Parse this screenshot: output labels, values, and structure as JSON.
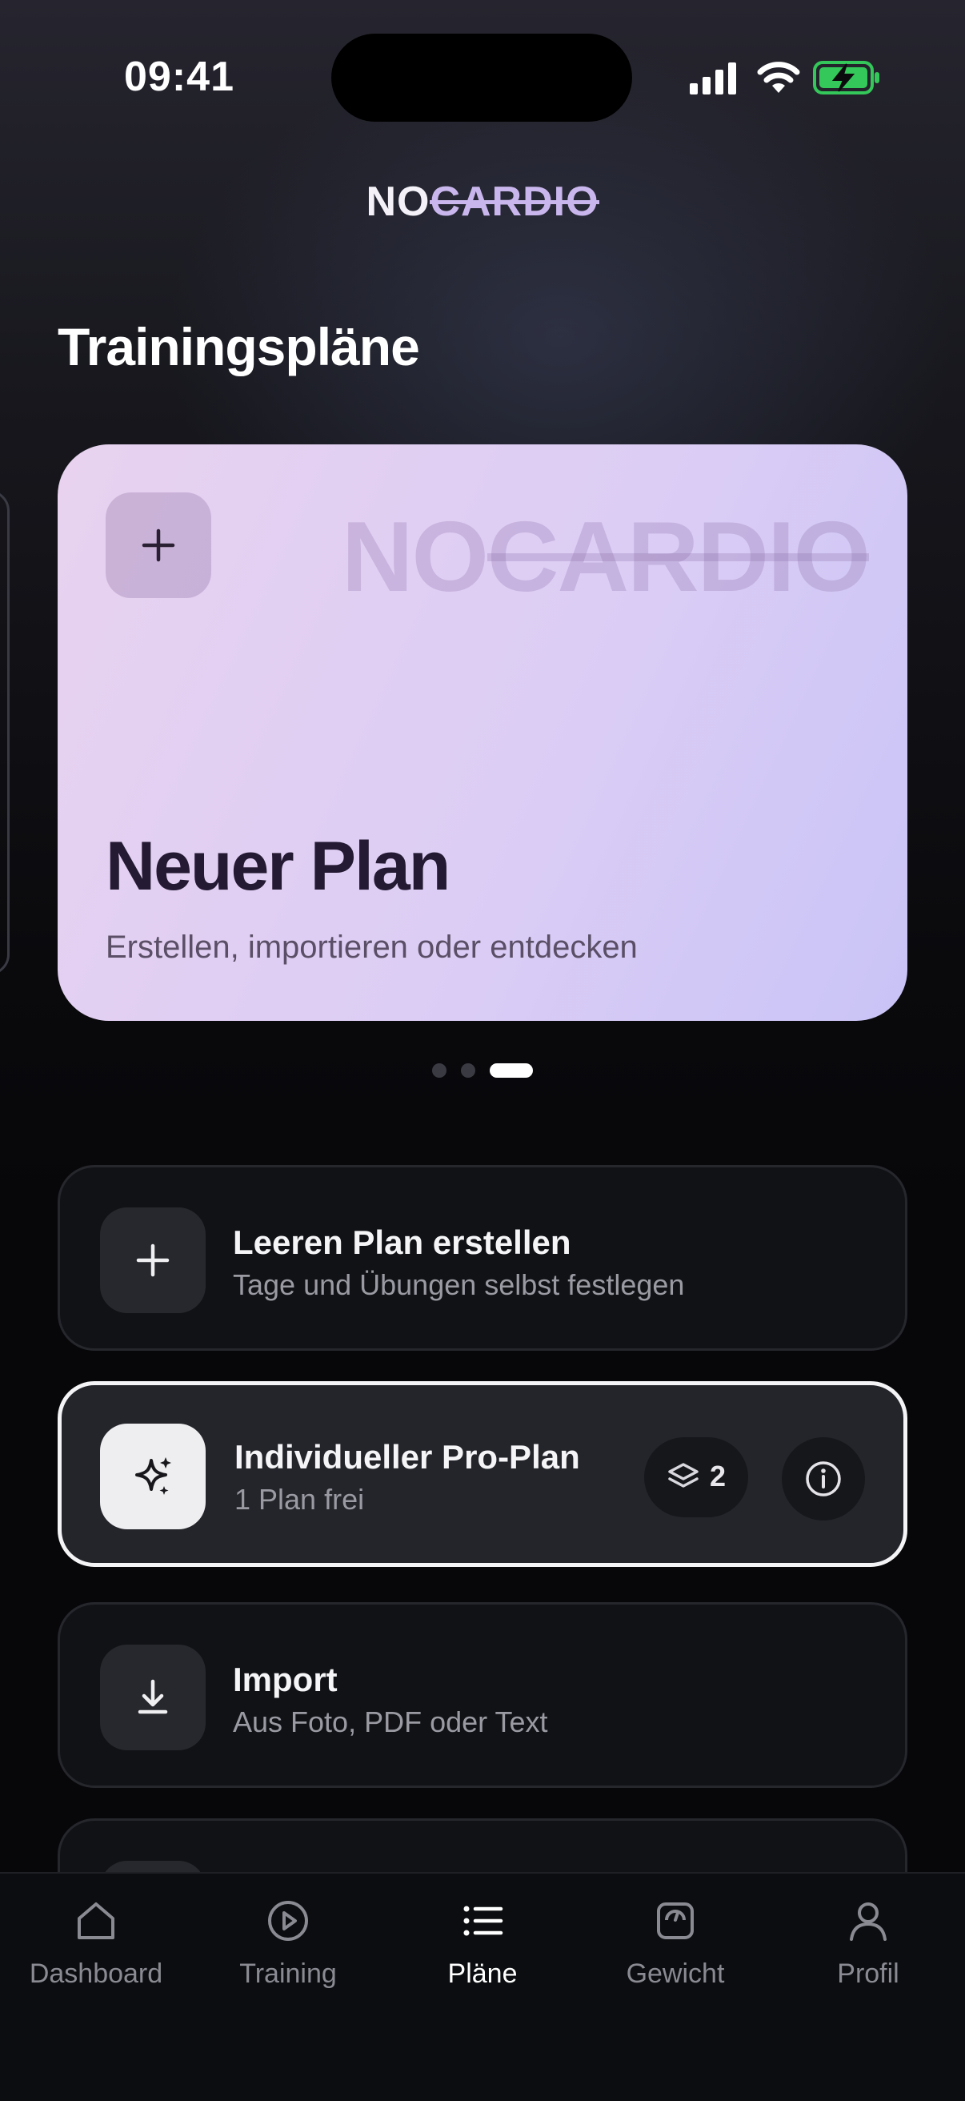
{
  "status_bar": {
    "time": "09:41"
  },
  "logo": {
    "prefix": "NO",
    "struck": "CARDIO"
  },
  "page_title": "Trainingspläne",
  "carousel": {
    "active_index": 2,
    "page_count": 3,
    "card": {
      "watermark_prefix": "NO",
      "watermark_struck": "CARDIO",
      "title": "Neuer Plan",
      "subtitle": "Erstellen, importieren oder entdecken"
    }
  },
  "actions": [
    {
      "title": "Leeren Plan erstellen",
      "subtitle": "Tage und Übungen selbst festlegen",
      "icon": "plus-icon"
    },
    {
      "title": "Individueller Pro-Plan",
      "subtitle": "1 Plan frei",
      "icon": "sparkle-icon",
      "badge_count": "2",
      "badge_icon": "layers-icon",
      "info_icon": "info-icon"
    },
    {
      "title": "Import",
      "subtitle": "Aus Foto, PDF oder Text",
      "icon": "download-icon"
    }
  ],
  "tabbar": {
    "items": [
      {
        "label": "Dashboard",
        "icon": "home-icon",
        "active": false
      },
      {
        "label": "Training",
        "icon": "play-icon",
        "active": false
      },
      {
        "label": "Pläne",
        "icon": "list-icon",
        "active": true
      },
      {
        "label": "Gewicht",
        "icon": "scale-icon",
        "active": false
      },
      {
        "label": "Profil",
        "icon": "user-icon",
        "active": false
      }
    ]
  },
  "colors": {
    "accent_lilac": "#c9b6ec",
    "card_gradient_start": "#e8d2ef",
    "card_gradient_end": "#c9c4f6",
    "battery_green": "#34c759"
  }
}
